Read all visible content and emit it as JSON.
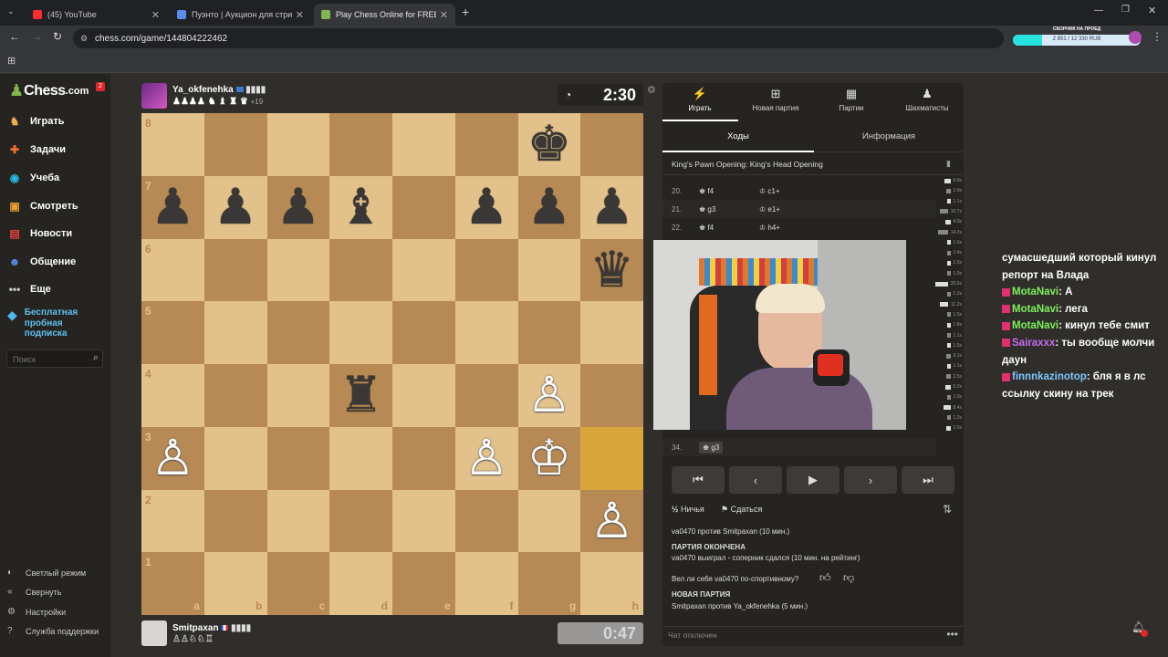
{
  "browser": {
    "tabs": [
      {
        "title": "(45) YouTube",
        "color": "#ff2d2d"
      },
      {
        "title": "Пуэнто | Аукцион для стример",
        "color": "#5b8df0"
      },
      {
        "title": "Play Chess Online for FREE - 2",
        "color": "#81b64c"
      }
    ],
    "new_tab": "+",
    "url": "chess.com/game/144804222462",
    "donation": {
      "label": "СБОРНИК НА ПРОЕД",
      "value": "2 851 / 12 330 RUB"
    }
  },
  "sidebar": {
    "logo": "Chess",
    "logo_suffix": ".com",
    "notif": "2",
    "items": [
      {
        "label": "Играть",
        "icon": "play-icon"
      },
      {
        "label": "Задачи",
        "icon": "puzzle-icon"
      },
      {
        "label": "Учеба",
        "icon": "learn-icon"
      },
      {
        "label": "Смотреть",
        "icon": "watch-icon"
      },
      {
        "label": "Новости",
        "icon": "news-icon"
      },
      {
        "label": "Общение",
        "icon": "social-icon"
      },
      {
        "label": "Еще",
        "icon": "more-icon"
      }
    ],
    "premium": "Бесплатная пробная подписка",
    "search_placeholder": "Поиск",
    "footer": [
      "Светлый режим",
      "Свернуть",
      "Настройки",
      "Служба поддержки"
    ]
  },
  "top_player": {
    "name": "Ya_okfenehka",
    "extra": "+19",
    "clock": "2:30"
  },
  "bottom_player": {
    "name": "Smitpaxan",
    "clock": "0:47"
  },
  "board": {
    "ranks": [
      "8",
      "7",
      "6",
      "5",
      "4",
      "3",
      "2",
      "1"
    ],
    "files": [
      "a",
      "b",
      "c",
      "d",
      "e",
      "f",
      "g",
      "h"
    ],
    "pieces": {
      "g8": "♚",
      "a7": "♟",
      "b7": "♟",
      "c7": "♟",
      "d7": "♝",
      "f7": "♟",
      "g7": "♟",
      "h7": "♟",
      "h6": "♛",
      "d4": "♜",
      "g4": "♙",
      "a3": "♙",
      "f3": "♙",
      "g3": "♔",
      "h2": "♙"
    },
    "highlight": [
      "h3"
    ]
  },
  "panel": {
    "tabs": [
      "Играть",
      "Новая партия",
      "Партии",
      "Шахматисты"
    ],
    "subtabs": [
      "Ходы",
      "Информация"
    ],
    "opening": "King's Pawn Opening: King's Head Opening",
    "moves": [
      {
        "num": "20.",
        "white": "f4",
        "black": "c1+"
      },
      {
        "num": "21.",
        "white": "g3",
        "black": "e1+"
      },
      {
        "num": "22.",
        "white": "f4",
        "black": "h4+"
      }
    ],
    "last_move": {
      "num": "34.",
      "white": "g3"
    },
    "times": [
      "6.9s",
      "2.9s",
      "1.1s",
      "10.7s",
      "4.0s",
      "14.2s",
      "1.5s",
      "1.4s",
      "1.5s",
      "1.0s",
      "20.6s",
      "1.2s",
      "11.2s",
      "1.5s",
      "1.8s",
      "1.1s",
      "1.5s",
      "3.1s",
      "1.1s",
      "2.5s",
      "5.2s",
      "1.0s",
      "8.4s",
      "1.2s",
      "2.5s"
    ],
    "draw": "Ничья",
    "resign": "Сдаться",
    "chat": [
      {
        "text": "va0470 против Smitpaxan (10 мин.)",
        "bold": false
      },
      {
        "text": "ПАРТИЯ ОКОНЧЕНА",
        "bold": true
      },
      {
        "text": "va0470 выиграл - соперник сдался (10 мин. на рейтинг)",
        "bold": false
      },
      {
        "text": "Вел ли себя va0470 по-спортивному?",
        "bold": false
      },
      {
        "text": "НОВАЯ ПАРТИЯ",
        "bold": true
      },
      {
        "text": "Smitpaxan против Ya_okfenehka (5 мин.)",
        "bold": false
      }
    ],
    "chat_disabled": "Чат отключен"
  },
  "twitch_chat": [
    {
      "user": "",
      "color": "#ffffff",
      "text": "сумасшедший который кинул репорт на Влада"
    },
    {
      "user": "MotaNavi",
      "color": "#7cf05b",
      "text": "А"
    },
    {
      "user": "MotaNavi",
      "color": "#7cf05b",
      "text": "лега"
    },
    {
      "user": "MotaNavi",
      "color": "#7cf05b",
      "text": "кинул тебе смит"
    },
    {
      "user": "Sairaxxx",
      "color": "#c56cf0",
      "text": "ты вообще молчи даун"
    },
    {
      "user": "finnnkazinotop",
      "color": "#7ec8ff",
      "text": "бля я в лс ссылку скину на трек"
    }
  ]
}
